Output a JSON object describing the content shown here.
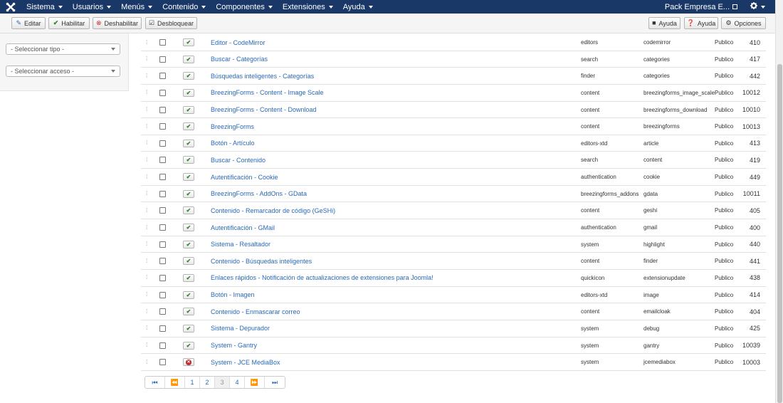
{
  "nav": {
    "menu": [
      {
        "label": "Sistema"
      },
      {
        "label": "Usuarios"
      },
      {
        "label": "Menús"
      },
      {
        "label": "Contenido"
      },
      {
        "label": "Componentes"
      },
      {
        "label": "Extensiones"
      },
      {
        "label": "Ayuda"
      }
    ],
    "site_name": "Pack Empresa E..."
  },
  "toolbar": {
    "edit": "Editar",
    "enable": "Habilitar",
    "disable": "Deshabilitar",
    "unlock": "Desbloquear",
    "help_video": "Ayuda",
    "help": "Ayuda",
    "options": "Opciones"
  },
  "filters": {
    "type": "- Seleccionar tipo -",
    "access": "- Seleccionar acceso -"
  },
  "plugins": [
    {
      "name": "Editor - CodeMirror",
      "folder": "editors",
      "element": "codemirror",
      "access": "Publico",
      "id": "410",
      "enabled": true
    },
    {
      "name": "Buscar - Categorías",
      "folder": "search",
      "element": "categories",
      "access": "Publico",
      "id": "417",
      "enabled": true
    },
    {
      "name": "Búsquedas inteligentes - Categorías",
      "folder": "finder",
      "element": "categories",
      "access": "Publico",
      "id": "442",
      "enabled": true
    },
    {
      "name": "BreezingForms - Content - Image Scale",
      "folder": "content",
      "element": "breezingforms_image_scale",
      "access": "Publico",
      "id": "10012",
      "enabled": true
    },
    {
      "name": "BreezingForms - Content - Download",
      "folder": "content",
      "element": "breezingforms_download",
      "access": "Publico",
      "id": "10010",
      "enabled": true
    },
    {
      "name": "BreezingForms",
      "folder": "content",
      "element": "breezingforms",
      "access": "Publico",
      "id": "10013",
      "enabled": true
    },
    {
      "name": "Botón - Artículo",
      "folder": "editors-xtd",
      "element": "article",
      "access": "Publico",
      "id": "413",
      "enabled": true
    },
    {
      "name": "Buscar - Contenido",
      "folder": "search",
      "element": "content",
      "access": "Publico",
      "id": "419",
      "enabled": true
    },
    {
      "name": "Autentificación - Cookie",
      "folder": "authentication",
      "element": "cookie",
      "access": "Publico",
      "id": "449",
      "enabled": true
    },
    {
      "name": "BreezingForms - AddOns - GData",
      "folder": "breezingforms_addons",
      "element": "gdata",
      "access": "Publico",
      "id": "10011",
      "enabled": true
    },
    {
      "name": "Contenido - Remarcador de código (GeSHi)",
      "folder": "content",
      "element": "geshi",
      "access": "Publico",
      "id": "405",
      "enabled": true
    },
    {
      "name": "Autentificación - GMail",
      "folder": "authentication",
      "element": "gmail",
      "access": "Publico",
      "id": "400",
      "enabled": true
    },
    {
      "name": "Sistema - Resaltador",
      "folder": "system",
      "element": "highlight",
      "access": "Publico",
      "id": "440",
      "enabled": true
    },
    {
      "name": "Contenido - Búsquedas inteligentes",
      "folder": "content",
      "element": "finder",
      "access": "Publico",
      "id": "441",
      "enabled": true
    },
    {
      "name": "Enlaces rápidos - Notificación de actualizaciones de extensiones para Joomla!",
      "folder": "quickicon",
      "element": "extensionupdate",
      "access": "Publico",
      "id": "438",
      "enabled": true
    },
    {
      "name": "Botón - Imagen",
      "folder": "editors-xtd",
      "element": "image",
      "access": "Publico",
      "id": "414",
      "enabled": true
    },
    {
      "name": "Contenido - Enmascarar correo",
      "folder": "content",
      "element": "emailcloak",
      "access": "Publico",
      "id": "404",
      "enabled": true
    },
    {
      "name": "Sistema - Depurador",
      "folder": "system",
      "element": "debug",
      "access": "Publico",
      "id": "425",
      "enabled": true
    },
    {
      "name": "System - Gantry",
      "folder": "system",
      "element": "gantry",
      "access": "Publico",
      "id": "10039",
      "enabled": true
    },
    {
      "name": "System - JCE MediaBox",
      "folder": "system",
      "element": "jcemediabox",
      "access": "Publico",
      "id": "10003",
      "enabled": false
    }
  ],
  "pagination": {
    "pages": [
      "1",
      "2",
      "3",
      "4"
    ],
    "current": "3"
  },
  "colors": {
    "navbar": "#1a3867",
    "link": "#2a69b8",
    "enabled": "#378137",
    "disabled": "#c52827"
  }
}
